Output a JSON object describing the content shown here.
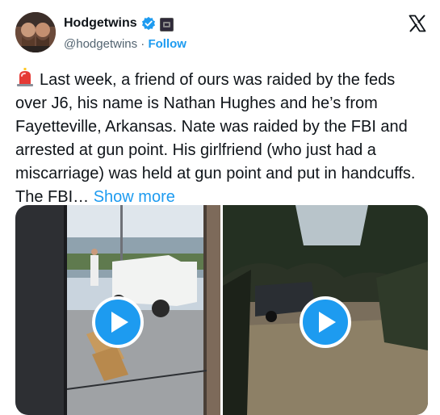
{
  "author": {
    "name": "Hodgetwins",
    "handle": "@hodgetwins",
    "separator": "·",
    "follow_label": "Follow"
  },
  "icons": {
    "verified": "verified-badge-icon",
    "affiliate": "affiliate-badge-icon",
    "platform": "x-logo-icon",
    "alert": "rotating-light-emoji"
  },
  "tweet": {
    "text": "Last week, a friend of ours was raided by the feds over J6, his name is Nathan Hughes and he’s from Fayetteville, Arkansas. Nate was raided by the FBI and arrested at gun point. His girlfriend (who just had a miscarriage) was held at gun point and put in handcuffs. The FBI…",
    "show_more_label": "Show more"
  },
  "colors": {
    "accent": "#1d9bf0",
    "text": "#0f1419",
    "secondary": "#536471"
  }
}
